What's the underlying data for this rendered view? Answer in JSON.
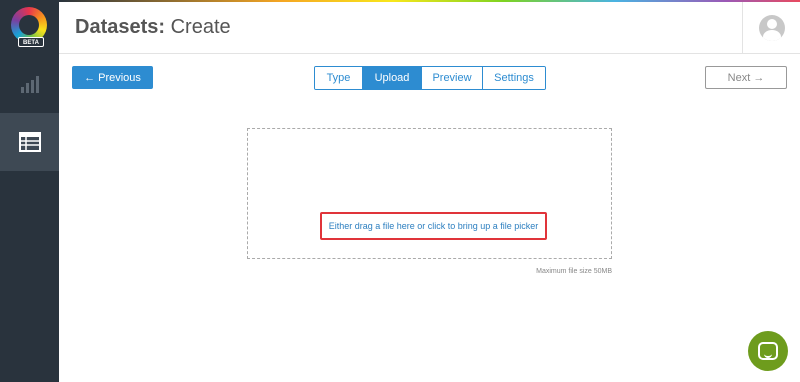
{
  "app": {
    "logo_badge": "BETA"
  },
  "sidebar": {
    "items": [
      {
        "name": "charts",
        "icon": "bar-chart-icon",
        "active": false
      },
      {
        "name": "datasets",
        "icon": "table-icon",
        "active": true
      }
    ]
  },
  "header": {
    "title_primary": "Datasets:",
    "title_secondary": "Create",
    "user_icon": "user-avatar-icon"
  },
  "wizard": {
    "previous_label": "← Previous",
    "next_label": "Next →",
    "next_enabled": false,
    "tabs": [
      {
        "label": "Type",
        "active": false
      },
      {
        "label": "Upload",
        "active": true
      },
      {
        "label": "Preview",
        "active": false
      },
      {
        "label": "Settings",
        "active": false
      }
    ]
  },
  "upload": {
    "prompt": "Either drag a file here or click to bring up a file picker",
    "max_size": "Maximum file size 50MB"
  },
  "colors": {
    "sidebar_bg": "#29333d",
    "sidebar_active": "#3e4954",
    "accent_blue": "#2d8cd1",
    "highlight_red": "#e0343a",
    "chat_green": "#6e9c1d"
  },
  "chat": {
    "icon": "chat-icon"
  }
}
